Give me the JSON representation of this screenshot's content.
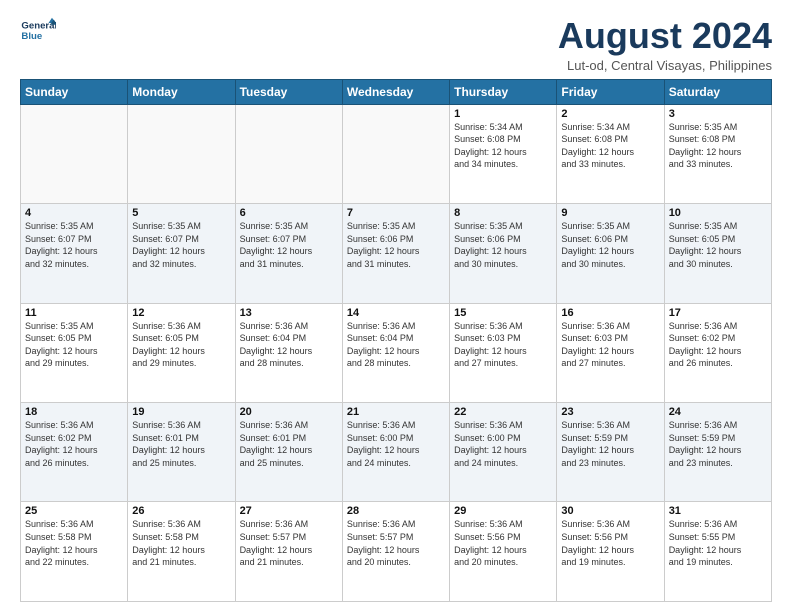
{
  "header": {
    "logo_line1": "General",
    "logo_line2": "Blue",
    "month_title": "August 2024",
    "location": "Lut-od, Central Visayas, Philippines"
  },
  "weekdays": [
    "Sunday",
    "Monday",
    "Tuesday",
    "Wednesday",
    "Thursday",
    "Friday",
    "Saturday"
  ],
  "weeks": [
    [
      {
        "day": "",
        "info": ""
      },
      {
        "day": "",
        "info": ""
      },
      {
        "day": "",
        "info": ""
      },
      {
        "day": "",
        "info": ""
      },
      {
        "day": "1",
        "info": "Sunrise: 5:34 AM\nSunset: 6:08 PM\nDaylight: 12 hours\nand 34 minutes."
      },
      {
        "day": "2",
        "info": "Sunrise: 5:34 AM\nSunset: 6:08 PM\nDaylight: 12 hours\nand 33 minutes."
      },
      {
        "day": "3",
        "info": "Sunrise: 5:35 AM\nSunset: 6:08 PM\nDaylight: 12 hours\nand 33 minutes."
      }
    ],
    [
      {
        "day": "4",
        "info": "Sunrise: 5:35 AM\nSunset: 6:07 PM\nDaylight: 12 hours\nand 32 minutes."
      },
      {
        "day": "5",
        "info": "Sunrise: 5:35 AM\nSunset: 6:07 PM\nDaylight: 12 hours\nand 32 minutes."
      },
      {
        "day": "6",
        "info": "Sunrise: 5:35 AM\nSunset: 6:07 PM\nDaylight: 12 hours\nand 31 minutes."
      },
      {
        "day": "7",
        "info": "Sunrise: 5:35 AM\nSunset: 6:06 PM\nDaylight: 12 hours\nand 31 minutes."
      },
      {
        "day": "8",
        "info": "Sunrise: 5:35 AM\nSunset: 6:06 PM\nDaylight: 12 hours\nand 30 minutes."
      },
      {
        "day": "9",
        "info": "Sunrise: 5:35 AM\nSunset: 6:06 PM\nDaylight: 12 hours\nand 30 minutes."
      },
      {
        "day": "10",
        "info": "Sunrise: 5:35 AM\nSunset: 6:05 PM\nDaylight: 12 hours\nand 30 minutes."
      }
    ],
    [
      {
        "day": "11",
        "info": "Sunrise: 5:35 AM\nSunset: 6:05 PM\nDaylight: 12 hours\nand 29 minutes."
      },
      {
        "day": "12",
        "info": "Sunrise: 5:36 AM\nSunset: 6:05 PM\nDaylight: 12 hours\nand 29 minutes."
      },
      {
        "day": "13",
        "info": "Sunrise: 5:36 AM\nSunset: 6:04 PM\nDaylight: 12 hours\nand 28 minutes."
      },
      {
        "day": "14",
        "info": "Sunrise: 5:36 AM\nSunset: 6:04 PM\nDaylight: 12 hours\nand 28 minutes."
      },
      {
        "day": "15",
        "info": "Sunrise: 5:36 AM\nSunset: 6:03 PM\nDaylight: 12 hours\nand 27 minutes."
      },
      {
        "day": "16",
        "info": "Sunrise: 5:36 AM\nSunset: 6:03 PM\nDaylight: 12 hours\nand 27 minutes."
      },
      {
        "day": "17",
        "info": "Sunrise: 5:36 AM\nSunset: 6:02 PM\nDaylight: 12 hours\nand 26 minutes."
      }
    ],
    [
      {
        "day": "18",
        "info": "Sunrise: 5:36 AM\nSunset: 6:02 PM\nDaylight: 12 hours\nand 26 minutes."
      },
      {
        "day": "19",
        "info": "Sunrise: 5:36 AM\nSunset: 6:01 PM\nDaylight: 12 hours\nand 25 minutes."
      },
      {
        "day": "20",
        "info": "Sunrise: 5:36 AM\nSunset: 6:01 PM\nDaylight: 12 hours\nand 25 minutes."
      },
      {
        "day": "21",
        "info": "Sunrise: 5:36 AM\nSunset: 6:00 PM\nDaylight: 12 hours\nand 24 minutes."
      },
      {
        "day": "22",
        "info": "Sunrise: 5:36 AM\nSunset: 6:00 PM\nDaylight: 12 hours\nand 24 minutes."
      },
      {
        "day": "23",
        "info": "Sunrise: 5:36 AM\nSunset: 5:59 PM\nDaylight: 12 hours\nand 23 minutes."
      },
      {
        "day": "24",
        "info": "Sunrise: 5:36 AM\nSunset: 5:59 PM\nDaylight: 12 hours\nand 23 minutes."
      }
    ],
    [
      {
        "day": "25",
        "info": "Sunrise: 5:36 AM\nSunset: 5:58 PM\nDaylight: 12 hours\nand 22 minutes."
      },
      {
        "day": "26",
        "info": "Sunrise: 5:36 AM\nSunset: 5:58 PM\nDaylight: 12 hours\nand 21 minutes."
      },
      {
        "day": "27",
        "info": "Sunrise: 5:36 AM\nSunset: 5:57 PM\nDaylight: 12 hours\nand 21 minutes."
      },
      {
        "day": "28",
        "info": "Sunrise: 5:36 AM\nSunset: 5:57 PM\nDaylight: 12 hours\nand 20 minutes."
      },
      {
        "day": "29",
        "info": "Sunrise: 5:36 AM\nSunset: 5:56 PM\nDaylight: 12 hours\nand 20 minutes."
      },
      {
        "day": "30",
        "info": "Sunrise: 5:36 AM\nSunset: 5:56 PM\nDaylight: 12 hours\nand 19 minutes."
      },
      {
        "day": "31",
        "info": "Sunrise: 5:36 AM\nSunset: 5:55 PM\nDaylight: 12 hours\nand 19 minutes."
      }
    ]
  ]
}
